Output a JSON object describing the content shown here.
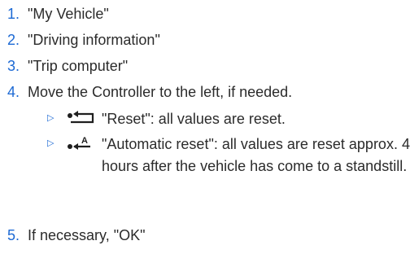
{
  "steps": [
    {
      "num": "1.",
      "text": "\"My Vehicle\""
    },
    {
      "num": "2.",
      "text": "\"Driving information\""
    },
    {
      "num": "3.",
      "text": "\"Trip computer\""
    },
    {
      "num": "4.",
      "text": "Move the Controller to the left, if needed."
    },
    {
      "num": "5.",
      "text": "If necessary, \"OK\""
    }
  ],
  "sub_steps": [
    {
      "bullet": "▷",
      "icon": "reset-arrow-icon",
      "text": "\"Reset\": all values are reset."
    },
    {
      "bullet": "▷",
      "icon": "automatic-reset-icon",
      "icon_letter": "A",
      "text": "\"Automatic reset\": all values are reset approx. 4 hours after the vehicle has come to a standstill."
    }
  ],
  "colors": {
    "accent": "#1c69d4",
    "text": "#2b2b2b"
  }
}
